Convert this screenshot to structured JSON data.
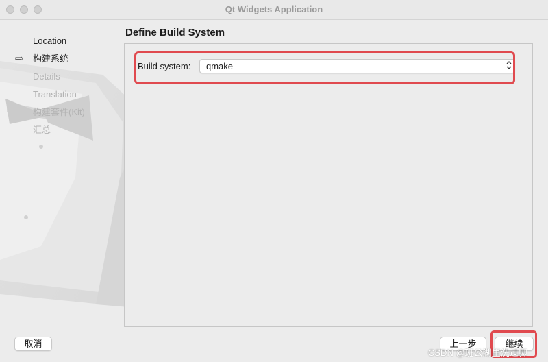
{
  "window": {
    "title": "Qt Widgets Application"
  },
  "sidebar": {
    "steps": [
      {
        "label": "Location",
        "active": false,
        "dim": false
      },
      {
        "label": "构建系统",
        "active": true,
        "dim": false
      },
      {
        "label": "Details",
        "active": false,
        "dim": true
      },
      {
        "label": "Translation",
        "active": false,
        "dim": true
      },
      {
        "label": "构建套件(Kit)",
        "active": false,
        "dim": true
      },
      {
        "label": "汇总",
        "active": false,
        "dim": true
      }
    ],
    "current_arrow": "⇨"
  },
  "main": {
    "page_title": "Define Build System",
    "build_system": {
      "label": "Build system:",
      "value": "qmake"
    }
  },
  "footer": {
    "cancel_label": "取消",
    "back_label": "上一步",
    "next_label": "继续"
  },
  "watermark": "CSDN @班公湖里洗过脚",
  "colors": {
    "annotation_red": "#e04a4f",
    "disabled_text": "#b3b3b3"
  }
}
